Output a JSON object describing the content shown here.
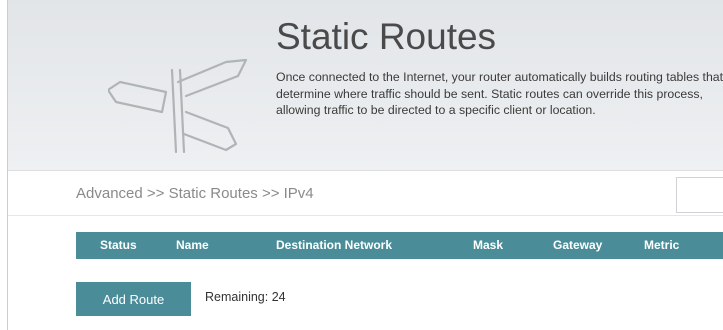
{
  "hero": {
    "title": "Static Routes",
    "description": "Once connected to the Internet, your router automatically builds routing tables that determine where traffic should be sent. Static routes can override this process, allowing traffic to be directed to a specific client or location.",
    "icon": "signpost-icon"
  },
  "breadcrumb": {
    "text": "Advanced >> Static Routes >> IPv4"
  },
  "table": {
    "columns": [
      "Status",
      "Name",
      "Destination Network",
      "Mask",
      "Gateway",
      "Metric"
    ],
    "rows": []
  },
  "actions": {
    "add_label": "Add Route",
    "remaining_label": "Remaining: 24"
  },
  "colors": {
    "accent": "#4a8d99",
    "hero_background": "#e6e9ec",
    "title_text": "#4a4a4a"
  }
}
